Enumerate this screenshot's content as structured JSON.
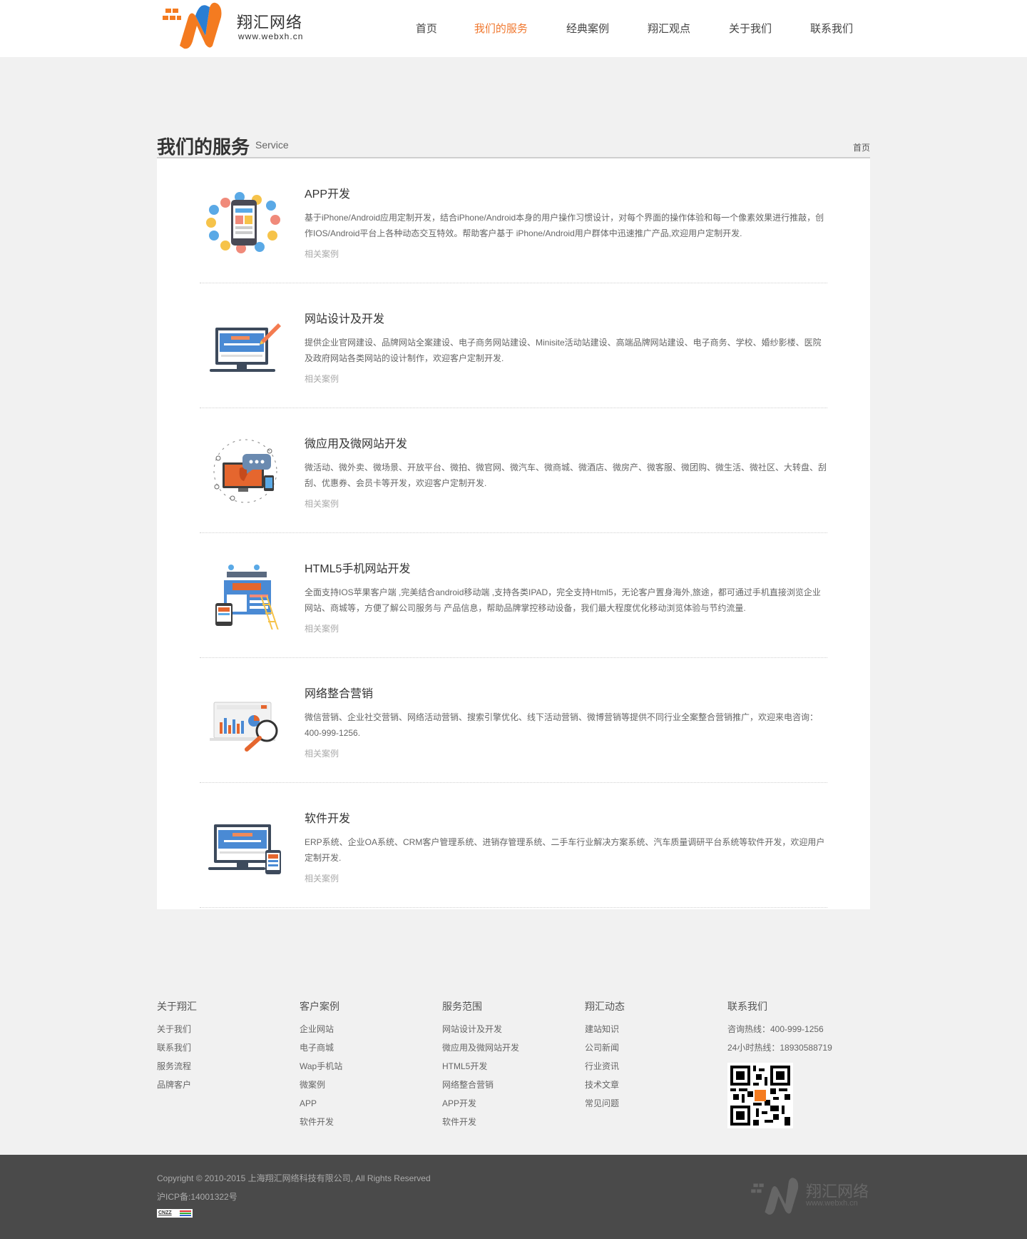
{
  "header": {
    "logo_cn": "翔汇网络",
    "logo_en": "www.webxh.cn",
    "nav": [
      "首页",
      "我们的服务",
      "经典案例",
      "翔汇观点",
      "关于我们",
      "联系我们"
    ],
    "active_index": 1
  },
  "page": {
    "title": "我们的服务",
    "title_en": "Service",
    "breadcrumb": "首页"
  },
  "services": [
    {
      "title": "APP开发",
      "desc": "基于iPhone/Android应用定制开发，结合iPhone/Android本身的用户操作习惯设计，对每个界面的操作体验和每一个像素效果进行推敲，创作IOS/Android平台上各种动态交互特效。帮助客户基于 iPhone/Android用户群体中迅速推广产品,欢迎用户定制开发.",
      "link": "相关案例",
      "icon": "mobile-apps-icon"
    },
    {
      "title": "网站设计及开发",
      "desc": "提供企业官网建设、品牌网站全案建设、电子商务网站建设、Minisite活动站建设、高端品牌网站建设、电子商务、学校、婚纱影楼、医院及政府网站各类网站的设计制作，欢迎客户定制开发.",
      "link": "相关案例",
      "icon": "website-design-icon"
    },
    {
      "title": "微应用及微网站开发",
      "desc": "微活动、微外卖、微场景、开放平台、微拍、微官网、微汽车、微商城、微酒店、微房产、微客服、微团购、微生活、微社区、大转盘、刮刮、优惠券、会员卡等开发，欢迎客户定制开发.",
      "link": "相关案例",
      "icon": "micro-apps-icon"
    },
    {
      "title": "HTML5手机网站开发",
      "desc": "全面支持IOS苹果客户端 ,完美结合android移动端 ,支持各类IPAD，完全支持Html5，无论客户置身海外,旅途，都可通过手机直接浏览企业网站、商城等，方便了解公司服务与 产品信息，帮助品牌掌控移动设备，我们最大程度优化移动浏览体验与节约流量.",
      "link": "相关案例",
      "icon": "html5-mobile-icon"
    },
    {
      "title": "网络整合营销",
      "desc": "微信营销、企业社交营销、网络活动营销、搜索引擎优化、线下活动营销、微博营销等提供不同行业全案整合营销推广，欢迎来电咨询：400-999-1256.",
      "link": "相关案例",
      "icon": "marketing-analytics-icon"
    },
    {
      "title": "软件开发",
      "desc": "ERP系统、企业OA系统、CRM客户管理系统、进销存管理系统、二手车行业解决方案系统、汽车质量调研平台系统等软件开发，欢迎用户定制开发.",
      "link": "相关案例",
      "icon": "software-dev-icon"
    }
  ],
  "footer": {
    "cols": [
      {
        "title": "关于翔汇",
        "items": [
          "关于我们",
          "联系我们",
          "服务流程",
          "品牌客户"
        ]
      },
      {
        "title": "客户案例",
        "items": [
          "企业网站",
          "电子商城",
          "Wap手机站",
          "微案例",
          "APP",
          "软件开发"
        ]
      },
      {
        "title": "服务范围",
        "items": [
          "网站设计及开发",
          "微应用及微网站开发",
          "HTML5开发",
          "网络整合营销",
          "APP开发",
          "软件开发"
        ]
      },
      {
        "title": "翔汇动态",
        "items": [
          "建站知识",
          "公司新闻",
          "行业资讯",
          "技术文章",
          "常见问题"
        ]
      }
    ],
    "contact": {
      "title": "联系我们",
      "hotline": "咨询热线：400-999-1256",
      "hotline24": "24小时热线：18930588719"
    },
    "copyright": "Copyright © 2010-2015 上海翔汇网络科技有限公司, All Rights Reserved",
    "icp": "沪ICP备:14001322号",
    "cnzz": "CNZZ",
    "logo_cn": "翔汇网络",
    "logo_en": "www.webxh.cn"
  },
  "colors": {
    "accent": "#f0782f",
    "logo_orange": "#f47b20",
    "logo_blue": "#2a7ed3",
    "footer_dark": "#4a4a4a"
  }
}
